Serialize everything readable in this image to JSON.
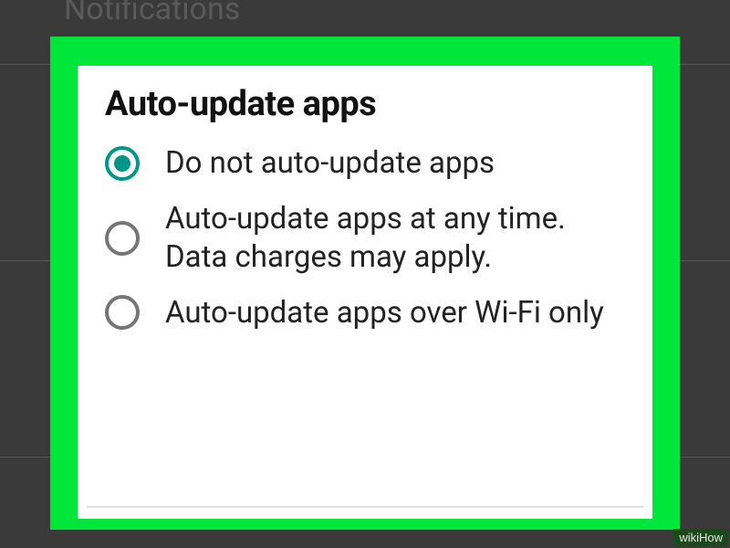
{
  "background": {
    "header": "Notifications"
  },
  "dialog": {
    "title": "Auto-update apps",
    "options": [
      {
        "label": "Do not auto-update apps",
        "selected": true
      },
      {
        "label": "Auto-update apps at any time. Data charges may apply.",
        "selected": false
      },
      {
        "label": "Auto-update apps over Wi-Fi only",
        "selected": false
      }
    ]
  },
  "watermark": "wikiHow"
}
